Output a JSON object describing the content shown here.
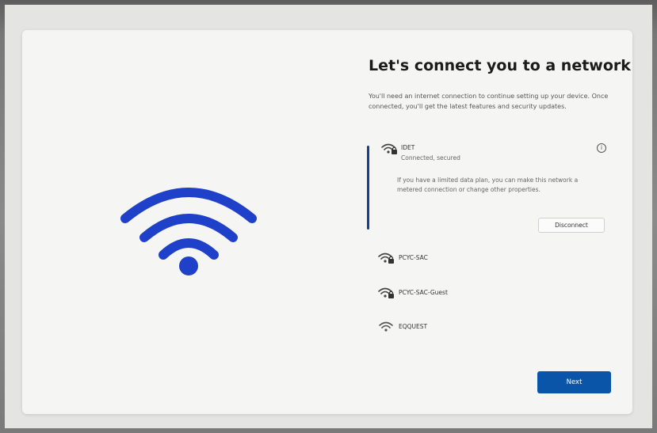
{
  "page": {
    "title": "Let's connect you to a network",
    "subtitle": "You'll need an internet connection to continue setting up your device. Once connected, you'll get the latest features and security updates."
  },
  "colors": {
    "accent": "#1a3d8c",
    "hero_icon": "#1f40c8",
    "next_button": "#0a55a8"
  },
  "networks": [
    {
      "name": "IDET",
      "status": "Connected, secured",
      "icon": "wifi-secured-icon",
      "expanded": true,
      "description": "If you have a limited data plan, you can make this network a metered connection or change other properties.",
      "action_label": "Disconnect"
    },
    {
      "name": "PCYC-SAC",
      "icon": "wifi-secured-icon"
    },
    {
      "name": "PCYC-SAC-Guest",
      "icon": "wifi-secured-icon"
    },
    {
      "name": "EQQUEST",
      "icon": "wifi-icon"
    }
  ],
  "buttons": {
    "next": "Next"
  },
  "icons": {
    "hero": "wifi-icon",
    "info": "info-icon"
  }
}
